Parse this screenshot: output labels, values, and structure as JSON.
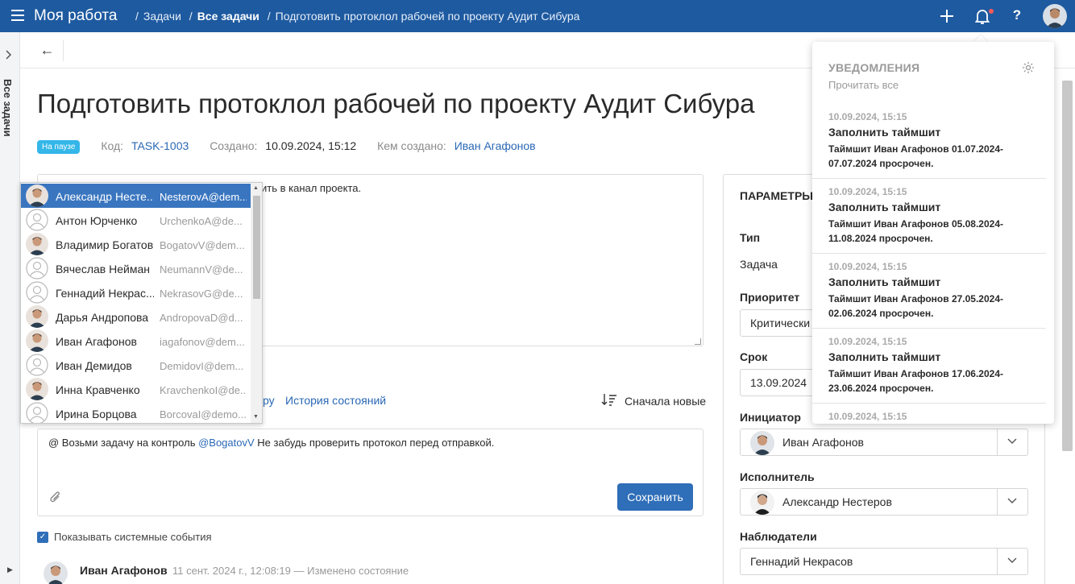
{
  "topbar": {
    "app_title": "Моя работа",
    "breadcrumbs": [
      "Задачи",
      "Все задачи",
      "Подготовить протоклол рабочей по проекту Аудит Сибура"
    ],
    "add_icon": "plus-icon",
    "bell_icon": "bell-icon",
    "help_label": "?"
  },
  "rail": {
    "label": "Все задачи"
  },
  "task": {
    "title": "Подготовить протоклол рабочей по проекту Аудит Сибура",
    "status": "На паузе",
    "code_label": "Код:",
    "code": "TASK-1003",
    "created_label": "Создано:",
    "created": "10.09.2024, 15:12",
    "author_label": "Кем создано:",
    "author": "Иван Агафонов",
    "description_fragment": "ить в канал проекта."
  },
  "tabs": {
    "fragment": "ру",
    "history": "История состояний",
    "sort_label": "Сначала новые"
  },
  "comment": {
    "text_prefix": "@ Возьми задачу на контроль ",
    "mention": "@BogatovV",
    "text_suffix": " Не забудь проверить протокол перед отправкой.",
    "save_label": "Сохранить"
  },
  "system_events": {
    "label": "Показывать системные события",
    "checked": true
  },
  "event": {
    "author": "Иван Агафонов",
    "meta": "11 сент. 2024 г., 12:08:19 — Изменено состояние"
  },
  "params": {
    "title": "ПАРАМЕТРЫ",
    "type_label": "Тип",
    "type_value": "Задача",
    "priority_label": "Приоритет",
    "priority_value": "Критически",
    "due_label": "Срок",
    "due_value": "13.09.2024",
    "initiator_label": "Инициатор",
    "initiator_value": "Иван Агафонов",
    "assignee_label": "Исполнитель",
    "assignee_value": "Александр Нестеров",
    "watchers_label": "Наблюдатели",
    "watchers_value": "Геннадий Некрасов"
  },
  "mention_list": [
    {
      "name": "Александр Несте...",
      "email": "NesterovA@dem...",
      "photo": true,
      "selected": true
    },
    {
      "name": "Антон Юрченко",
      "email": "UrchenkoA@de...",
      "photo": false
    },
    {
      "name": "Владимир Богатов",
      "email": "BogatovV@dem...",
      "photo": true
    },
    {
      "name": "Вячеслав Нейман",
      "email": "NeumannV@de...",
      "photo": false
    },
    {
      "name": "Геннадий Некрас...",
      "email": "NekrasovG@de...",
      "photo": false
    },
    {
      "name": "Дарья Андропова",
      "email": "AndropovaD@d...",
      "photo": true
    },
    {
      "name": "Иван Агафонов",
      "email": "iagafonov@dem...",
      "photo": true
    },
    {
      "name": "Иван Демидов",
      "email": "DemidovI@dem...",
      "photo": false
    },
    {
      "name": "Инна Кравченко",
      "email": "KravchenkoI@de...",
      "photo": true
    },
    {
      "name": "Ирина Борцова",
      "email": "BorcovaI@demo...",
      "photo": false
    }
  ],
  "notifications": {
    "title": "УВЕДОМЛЕНИЯ",
    "read_all": "Прочитать все",
    "items": [
      {
        "date": "10.09.2024, 15:15",
        "title": "Заполнить таймшит",
        "body": "Таймшит Иван Агафонов 01.07.2024-07.07.2024 просрочен."
      },
      {
        "date": "10.09.2024, 15:15",
        "title": "Заполнить таймшит",
        "body": "Таймшит Иван Агафонов 05.08.2024-11.08.2024 просрочен."
      },
      {
        "date": "10.09.2024, 15:15",
        "title": "Заполнить таймшит",
        "body": "Таймшит Иван Агафонов 27.05.2024-02.06.2024 просрочен."
      },
      {
        "date": "10.09.2024, 15:15",
        "title": "Заполнить таймшит",
        "body": "Таймшит Иван Агафонов 17.06.2024-23.06.2024 просрочен."
      },
      {
        "date": "10.09.2024, 15:15",
        "title": "",
        "body": ""
      }
    ]
  },
  "colors": {
    "brand": "#1e5aa0",
    "accent": "#2f6eb8",
    "status_badge": "#34b6e8",
    "link": "#2a68b5"
  }
}
